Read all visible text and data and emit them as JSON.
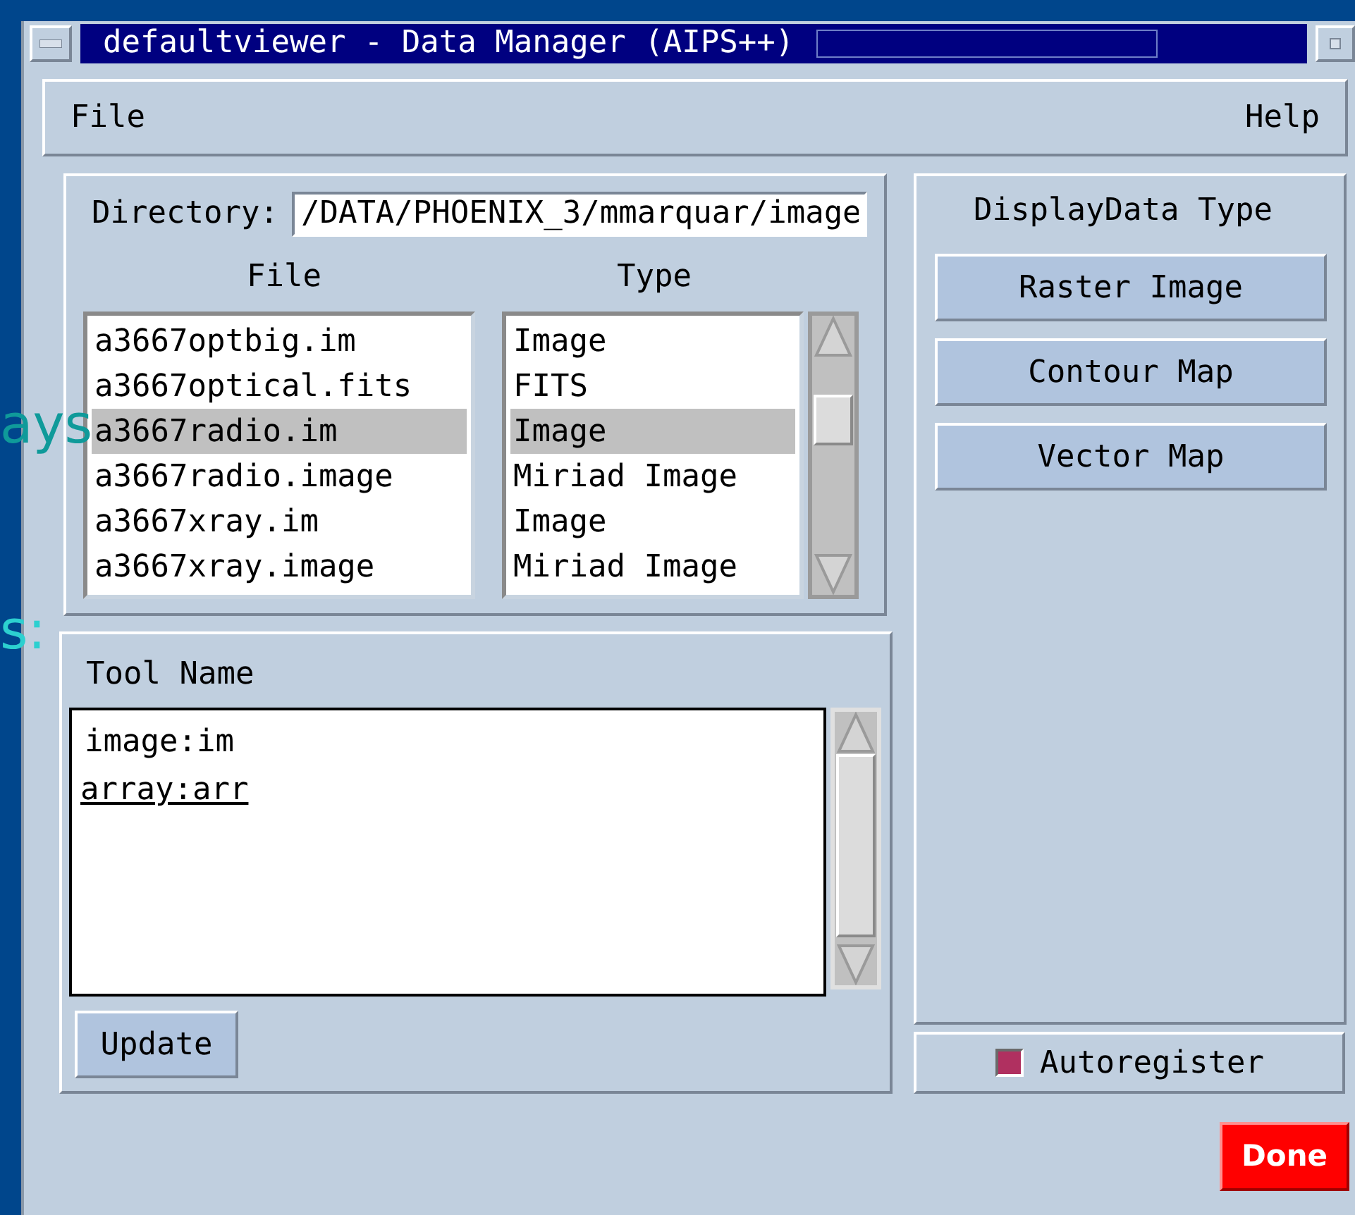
{
  "window": {
    "title": "defaultviewer - Data Manager (AIPS++)"
  },
  "menu": [
    "File",
    "Help"
  ],
  "directory": {
    "label": "Directory:",
    "value": "/DATA/PHOENIX_3/mmarquar/image"
  },
  "file_list": {
    "columns": [
      "File",
      "Type"
    ],
    "rows": [
      {
        "file": "a3667optbig.im",
        "type": "Image",
        "selected": false
      },
      {
        "file": "a3667optical.fits",
        "type": "FITS",
        "selected": false
      },
      {
        "file": "a3667radio.im",
        "type": "Image",
        "selected": true
      },
      {
        "file": "a3667radio.image",
        "type": "Miriad Image",
        "selected": false
      },
      {
        "file": "a3667xray.im",
        "type": "Image",
        "selected": false
      },
      {
        "file": "a3667xray.image",
        "type": "Miriad Image",
        "selected": false
      }
    ]
  },
  "tool_list": {
    "label": "Tool Name",
    "items": [
      {
        "text": "image:im",
        "focused": false
      },
      {
        "text": "array:arr",
        "focused": true
      }
    ]
  },
  "update_button": "Update",
  "display_type": {
    "title": "DisplayData Type",
    "buttons": [
      "Raster Image",
      "Contour Map",
      "Vector Map"
    ]
  },
  "autoregister": {
    "label": "Autoregister",
    "checked": true
  },
  "done_button": "Done",
  "background_text": [
    "ays",
    "s:"
  ]
}
